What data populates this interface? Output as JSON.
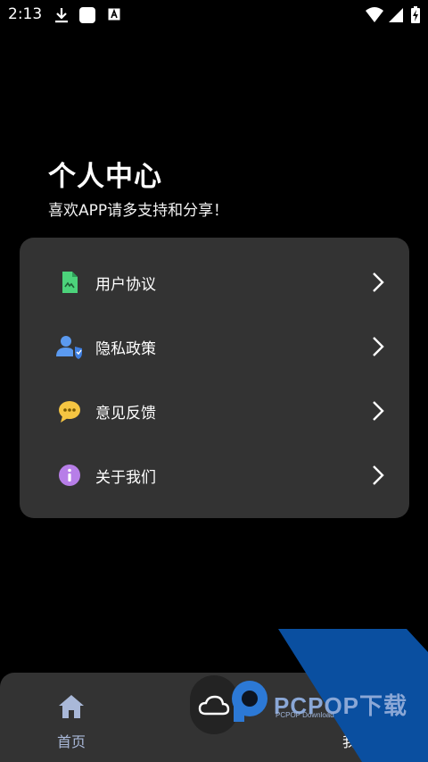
{
  "status_bar": {
    "time": "2:13",
    "left_icons": [
      "download-icon",
      "app-icon",
      "a-icon"
    ],
    "right_icons": [
      "wifi-icon",
      "signal-icon",
      "battery-icon"
    ]
  },
  "header": {
    "title": "个人中心",
    "subtitle": "喜欢APP请多支持和分享！"
  },
  "menu": {
    "items": [
      {
        "label": "用户协议",
        "icon": "document-icon",
        "color": "#4cd37b"
      },
      {
        "label": "隐私政策",
        "icon": "user-shield-icon",
        "color": "#5b9af0"
      },
      {
        "label": "意见反馈",
        "icon": "chat-bubble-icon",
        "color": "#f5c542"
      },
      {
        "label": "关于我们",
        "icon": "info-icon",
        "color": "#b77ee8"
      }
    ]
  },
  "bottom_nav": {
    "home_label": "首页",
    "center_icon": "cloud-icon",
    "mine_label": "我的"
  },
  "watermark": {
    "text": "PCPOP下载",
    "subtext": "PCPOP Download"
  },
  "colors": {
    "background": "#000000",
    "card": "#333333",
    "nav_active": "#a9b8d8"
  }
}
